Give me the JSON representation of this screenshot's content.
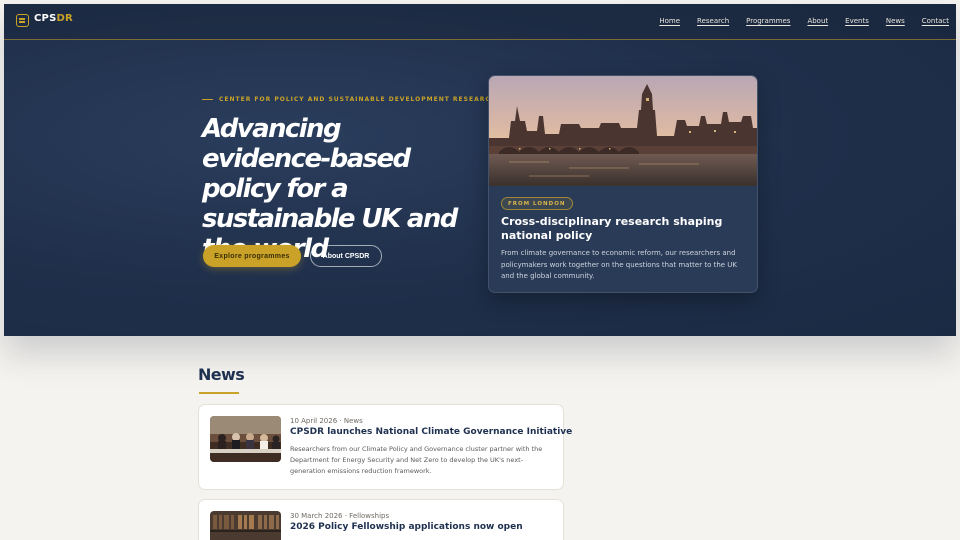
{
  "brand": {
    "name_prefix": "CPS",
    "name_accent": "DR"
  },
  "nav": [
    {
      "label": "Home"
    },
    {
      "label": "Research"
    },
    {
      "label": "Programmes"
    },
    {
      "label": "About"
    },
    {
      "label": "Events"
    },
    {
      "label": "News"
    },
    {
      "label": "Contact"
    }
  ],
  "hero": {
    "eyebrow": "CENTER FOR POLICY AND SUSTAINABLE DEVELOPMENT RESEARCH",
    "headline": "Advancing evidence-based policy for a sustainable UK and the world",
    "primary_button": "Explore programmes",
    "secondary_button": "About CPSDR"
  },
  "feature_card": {
    "badge": "FROM LONDON",
    "title": "Cross-disciplinary research shaping national policy",
    "description": "From climate governance to economic reform, our researchers and policymakers work together on the questions that matter to the UK and the global community."
  },
  "news": {
    "section_title": "News",
    "items": [
      {
        "meta": "10 April 2026 · News",
        "title": "CPSDR launches National Climate Governance Initiative",
        "body": "Researchers from our Climate Policy and Governance cluster partner with the Department for Energy Security and Net Zero to develop the UK's next-generation emissions reduction framework."
      },
      {
        "meta": "30 March 2026 · Fellowships",
        "title": "2026 Policy Fellowship applications now open",
        "body": ""
      }
    ]
  },
  "colors": {
    "navy": "#1f2f4a",
    "gold": "#c9a227",
    "page_bg": "#f5f3ef"
  }
}
